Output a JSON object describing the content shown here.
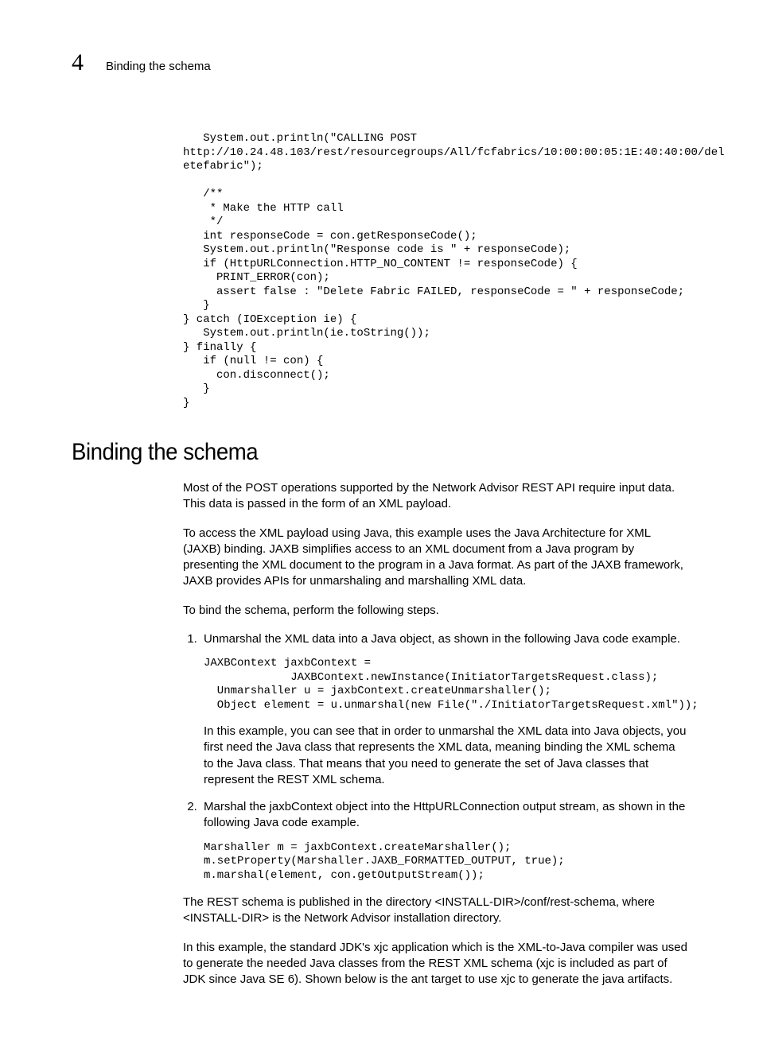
{
  "header": {
    "chapter_num": "4",
    "running_title": "Binding the schema"
  },
  "code1": "   System.out.println(\"CALLING POST\nhttp://10.24.48.103/rest/resourcegroups/All/fcfabrics/10:00:00:05:1E:40:40:00/del\netefabric\");\n\n   /**\n    * Make the HTTP call\n    */\n   int responseCode = con.getResponseCode();\n   System.out.println(\"Response code is \" + responseCode);\n   if (HttpURLConnection.HTTP_NO_CONTENT != responseCode) {\n     PRINT_ERROR(con);\n     assert false : \"Delete Fabric FAILED, responseCode = \" + responseCode;\n   }\n} catch (IOException ie) {\n   System.out.println(ie.toString());\n} finally {\n   if (null != con) {\n     con.disconnect();\n   }\n}",
  "section_title": "Binding the schema",
  "para1": "Most of the POST operations supported by the Network Advisor REST API require input data. This data is passed in the form of an XML payload.",
  "para2": "To access the XML payload using Java, this example uses the Java Architecture for XML (JAXB) binding. JAXB simplifies access to an XML document from a Java program by presenting the XML document to the program in a Java format. As part of the JAXB framework, JAXB provides APIs for unmarshaling and marshalling XML data.",
  "para3": "To bind the schema, perform the following steps.",
  "steps": {
    "s1_text": "Unmarshal the XML data into a Java object, as shown in the following Java code example.",
    "s1_code": "JAXBContext jaxbContext =\n             JAXBContext.newInstance(InitiatorTargetsRequest.class);\n  Unmarshaller u = jaxbContext.createUnmarshaller();\n  Object element = u.unmarshal(new File(\"./InitiatorTargetsRequest.xml\"));",
    "s1_after": "In this example, you can see that in order to unmarshal the XML data into Java objects, you first need the Java class that represents the XML data, meaning binding the XML schema to the Java class. That means that you need to generate the set of Java classes that represent the REST XML schema.",
    "s2_text": "Marshal the jaxbContext object into the HttpURLConnection output stream, as shown in the following Java code example.",
    "s2_code": "Marshaller m = jaxbContext.createMarshaller();\nm.setProperty(Marshaller.JAXB_FORMATTED_OUTPUT, true);\nm.marshal(element, con.getOutputStream());"
  },
  "para4": "The REST schema is published in the directory <INSTALL-DIR>/conf/rest-schema, where <INSTALL-DIR> is the Network Advisor installation directory.",
  "para5": "In this example, the standard JDK's xjc application which is the XML-to-Java compiler was used to generate the needed Java classes from the REST XML schema (xjc is included as part of JDK since Java SE 6). Shown below is the ant target to use xjc to generate the java artifacts."
}
